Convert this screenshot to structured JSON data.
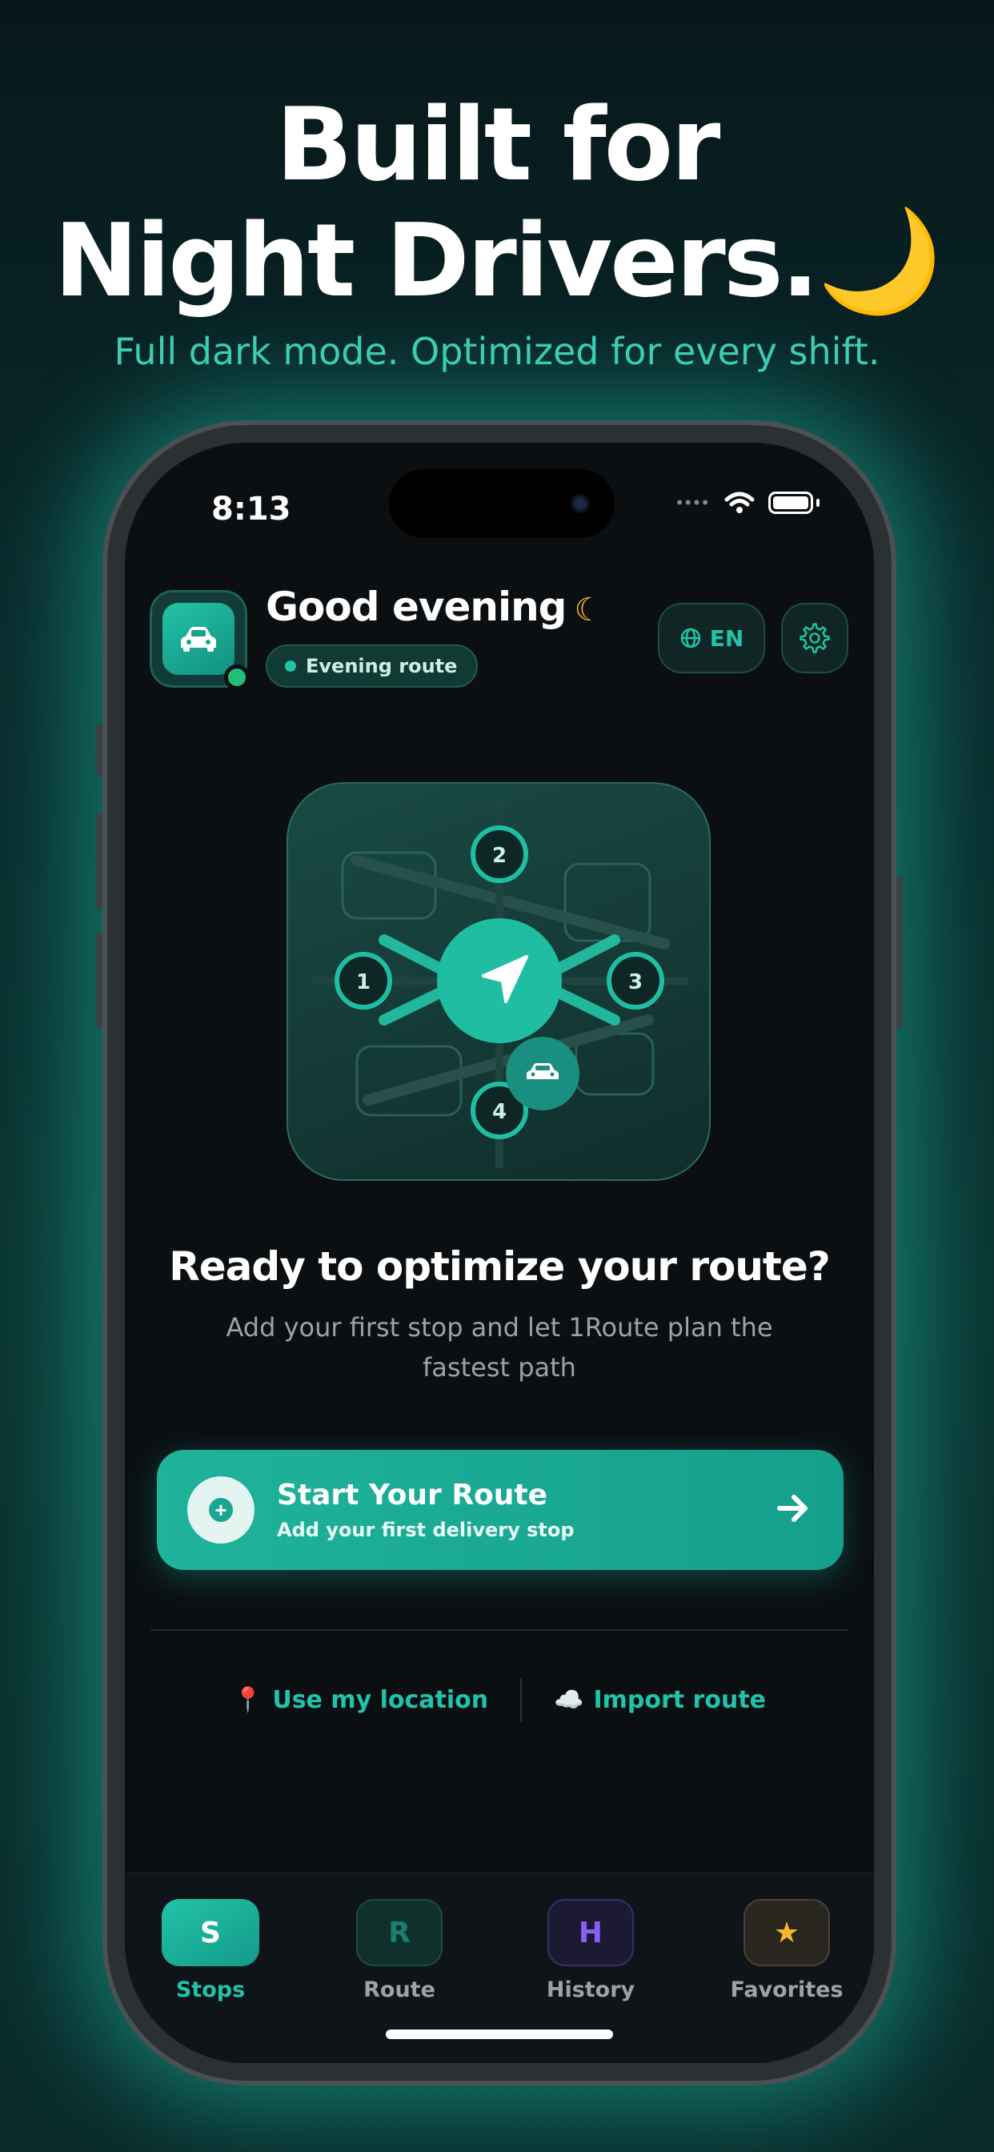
{
  "hero": {
    "line1": "Built for",
    "line2": "Night Drivers.",
    "line2_emoji": "🌙",
    "subtitle": "Full dark mode. Optimized for every shift."
  },
  "status_bar": {
    "time": "8:13"
  },
  "header": {
    "greeting": "Good evening",
    "greeting_icon": "crescent-moon-icon",
    "route_pill": "Evening route",
    "language": "EN"
  },
  "illustration": {
    "stops": [
      "1",
      "2",
      "3",
      "4"
    ]
  },
  "empty_state": {
    "title": "Ready to optimize your route?",
    "subtitle": "Add your first stop and let 1Route plan the fastest path"
  },
  "cta": {
    "title": "Start Your Route",
    "subtitle": "Add your first delivery stop"
  },
  "links": {
    "location": "Use my location",
    "location_emoji": "📍",
    "import": "Import route",
    "import_emoji": "☁️"
  },
  "tabs": [
    {
      "letter": "S",
      "label": "Stops",
      "active": true
    },
    {
      "letter": "R",
      "label": "Route",
      "active": false
    },
    {
      "letter": "H",
      "label": "History",
      "active": false
    },
    {
      "letter": "★",
      "label": "Favorites",
      "active": false
    }
  ],
  "colors": {
    "accent": "#22c3a8",
    "background": "#0b0f12",
    "moon": "#f5b72d",
    "history": "#8b5cf6"
  }
}
